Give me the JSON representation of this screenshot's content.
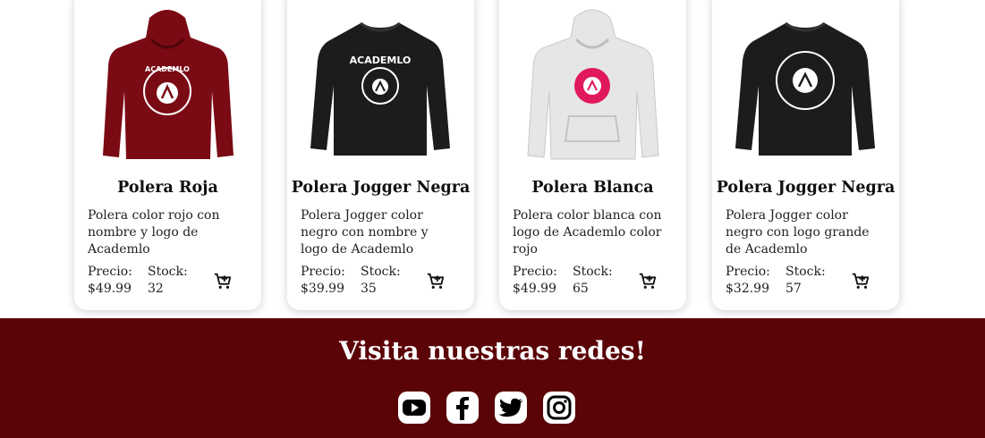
{
  "products": [
    {
      "name": "Polera Roja",
      "description": "Polera color rojo con nombre y logo de Academlo",
      "price_label": "Precio:",
      "price": "$49.99",
      "stock_label": "Stock:",
      "stock": "32",
      "color": "#7a0a14",
      "logo_text": "ACADEMLO"
    },
    {
      "name": "Polera Jogger Negra",
      "description": "Polera Jogger color negro con nombre y logo de Academlo",
      "price_label": "Precio:",
      "price": "$39.99",
      "stock_label": "Stock:",
      "stock": "35",
      "color": "#1c1c1c",
      "logo_text": "ACADEMLO"
    },
    {
      "name": "Polera Blanca",
      "description": "Polera color blanca con logo de Academlo color rojo",
      "price_label": "Precio:",
      "price": "$49.99",
      "stock_label": "Stock:",
      "stock": "65",
      "color": "#e6e6e6",
      "logo_text": ""
    },
    {
      "name": "Polera Jogger Negra",
      "description": "Polera Jogger color negro con logo grande de Academlo",
      "price_label": "Precio:",
      "price": "$32.99",
      "stock_label": "Stock:",
      "stock": "57",
      "color": "#1c1c1c",
      "logo_text": ""
    }
  ],
  "footer": {
    "title": "Visita nuestras redes!",
    "background": "#5b0407",
    "social_icons": [
      "youtube-icon",
      "facebook-icon",
      "twitter-icon",
      "instagram-icon"
    ]
  }
}
